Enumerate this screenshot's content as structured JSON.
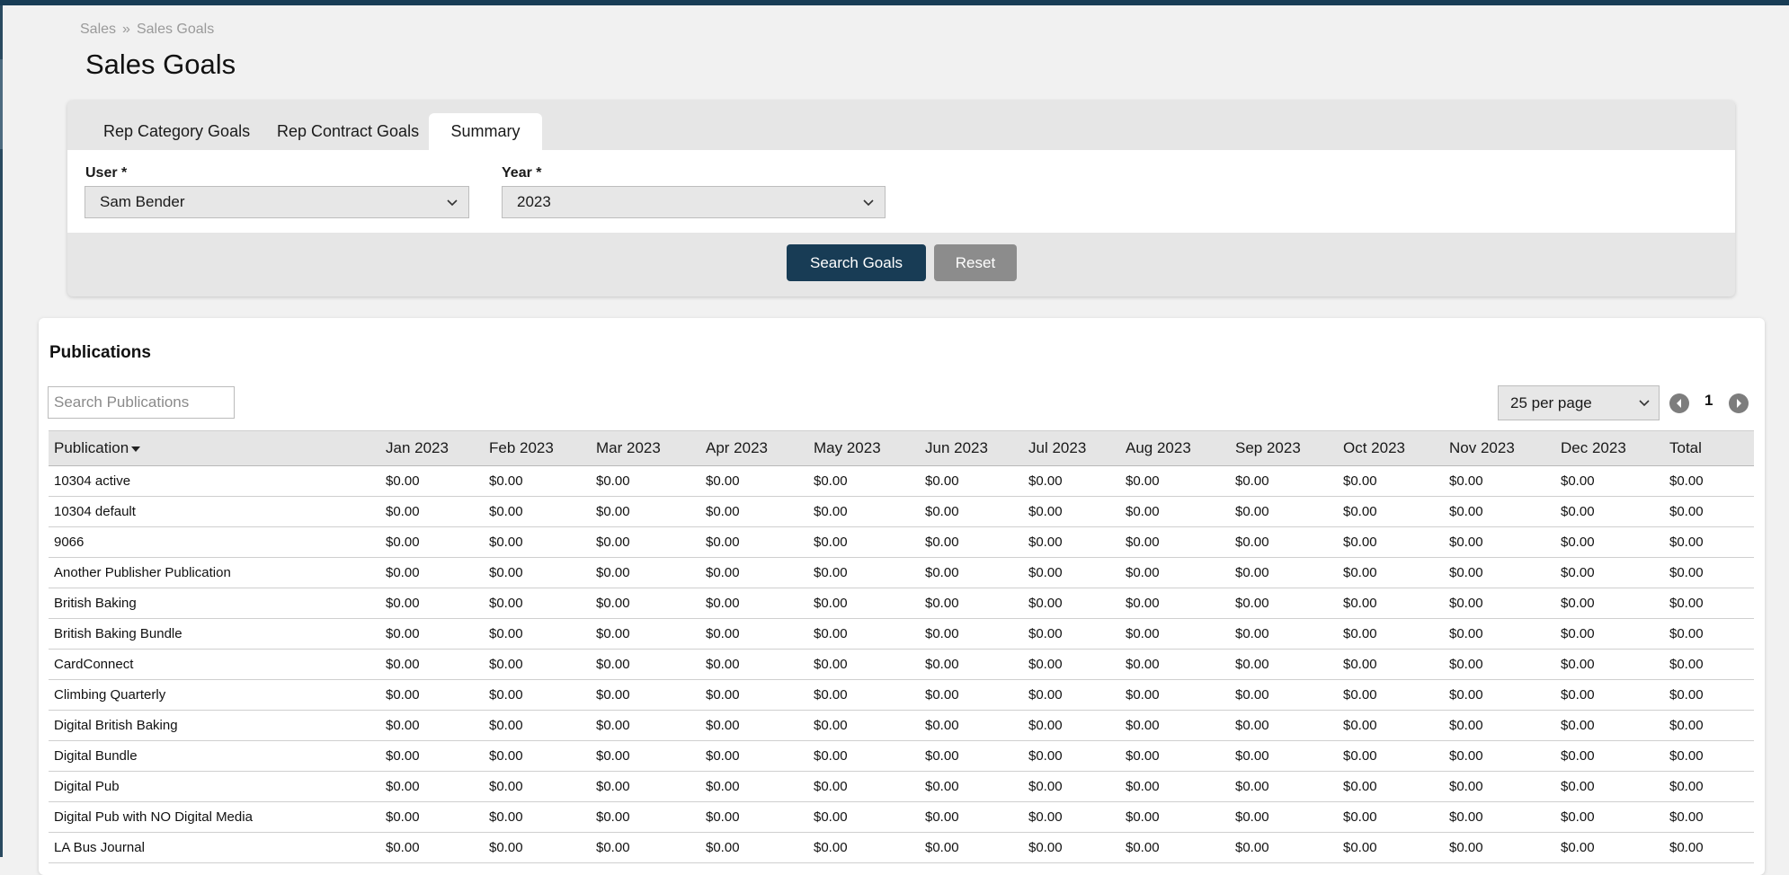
{
  "breadcrumb": {
    "parent": "Sales",
    "separator": "»",
    "current": "Sales Goals"
  },
  "page_title": "Sales Goals",
  "tabs": [
    {
      "label": "Rep Category Goals",
      "active": false
    },
    {
      "label": "Rep Contract Goals",
      "active": false
    },
    {
      "label": "Summary",
      "active": true
    }
  ],
  "filters": {
    "user_label": "User *",
    "user_value": "Sam Bender",
    "year_label": "Year *",
    "year_value": "2023"
  },
  "buttons": {
    "search": "Search Goals",
    "reset": "Reset"
  },
  "publications": {
    "title": "Publications",
    "search_placeholder": "Search Publications",
    "per_page": "25 per page",
    "page": "1",
    "columns": [
      "Publication",
      "Jan 2023",
      "Feb 2023",
      "Mar 2023",
      "Apr 2023",
      "May 2023",
      "Jun 2023",
      "Jul 2023",
      "Aug 2023",
      "Sep 2023",
      "Oct 2023",
      "Nov 2023",
      "Dec 2023",
      "Total"
    ],
    "rows": [
      {
        "name": "10304 active",
        "values": [
          "$0.00",
          "$0.00",
          "$0.00",
          "$0.00",
          "$0.00",
          "$0.00",
          "$0.00",
          "$0.00",
          "$0.00",
          "$0.00",
          "$0.00",
          "$0.00",
          "$0.00"
        ]
      },
      {
        "name": "10304 default",
        "values": [
          "$0.00",
          "$0.00",
          "$0.00",
          "$0.00",
          "$0.00",
          "$0.00",
          "$0.00",
          "$0.00",
          "$0.00",
          "$0.00",
          "$0.00",
          "$0.00",
          "$0.00"
        ]
      },
      {
        "name": "9066",
        "values": [
          "$0.00",
          "$0.00",
          "$0.00",
          "$0.00",
          "$0.00",
          "$0.00",
          "$0.00",
          "$0.00",
          "$0.00",
          "$0.00",
          "$0.00",
          "$0.00",
          "$0.00"
        ]
      },
      {
        "name": "Another Publisher Publication",
        "values": [
          "$0.00",
          "$0.00",
          "$0.00",
          "$0.00",
          "$0.00",
          "$0.00",
          "$0.00",
          "$0.00",
          "$0.00",
          "$0.00",
          "$0.00",
          "$0.00",
          "$0.00"
        ]
      },
      {
        "name": "British Baking",
        "values": [
          "$0.00",
          "$0.00",
          "$0.00",
          "$0.00",
          "$0.00",
          "$0.00",
          "$0.00",
          "$0.00",
          "$0.00",
          "$0.00",
          "$0.00",
          "$0.00",
          "$0.00"
        ]
      },
      {
        "name": "British Baking Bundle",
        "values": [
          "$0.00",
          "$0.00",
          "$0.00",
          "$0.00",
          "$0.00",
          "$0.00",
          "$0.00",
          "$0.00",
          "$0.00",
          "$0.00",
          "$0.00",
          "$0.00",
          "$0.00"
        ]
      },
      {
        "name": "CardConnect",
        "values": [
          "$0.00",
          "$0.00",
          "$0.00",
          "$0.00",
          "$0.00",
          "$0.00",
          "$0.00",
          "$0.00",
          "$0.00",
          "$0.00",
          "$0.00",
          "$0.00",
          "$0.00"
        ]
      },
      {
        "name": "Climbing Quarterly",
        "values": [
          "$0.00",
          "$0.00",
          "$0.00",
          "$0.00",
          "$0.00",
          "$0.00",
          "$0.00",
          "$0.00",
          "$0.00",
          "$0.00",
          "$0.00",
          "$0.00",
          "$0.00"
        ]
      },
      {
        "name": "Digital British Baking",
        "values": [
          "$0.00",
          "$0.00",
          "$0.00",
          "$0.00",
          "$0.00",
          "$0.00",
          "$0.00",
          "$0.00",
          "$0.00",
          "$0.00",
          "$0.00",
          "$0.00",
          "$0.00"
        ]
      },
      {
        "name": "Digital Bundle",
        "values": [
          "$0.00",
          "$0.00",
          "$0.00",
          "$0.00",
          "$0.00",
          "$0.00",
          "$0.00",
          "$0.00",
          "$0.00",
          "$0.00",
          "$0.00",
          "$0.00",
          "$0.00"
        ]
      },
      {
        "name": "Digital Pub",
        "values": [
          "$0.00",
          "$0.00",
          "$0.00",
          "$0.00",
          "$0.00",
          "$0.00",
          "$0.00",
          "$0.00",
          "$0.00",
          "$0.00",
          "$0.00",
          "$0.00",
          "$0.00"
        ]
      },
      {
        "name": "Digital Pub with NO Digital Media",
        "values": [
          "$0.00",
          "$0.00",
          "$0.00",
          "$0.00",
          "$0.00",
          "$0.00",
          "$0.00",
          "$0.00",
          "$0.00",
          "$0.00",
          "$0.00",
          "$0.00",
          "$0.00"
        ]
      },
      {
        "name": "LA Bus Journal",
        "values": [
          "$0.00",
          "$0.00",
          "$0.00",
          "$0.00",
          "$0.00",
          "$0.00",
          "$0.00",
          "$0.00",
          "$0.00",
          "$0.00",
          "$0.00",
          "$0.00",
          "$0.00"
        ]
      }
    ]
  },
  "colors": {
    "primary": "#183c55",
    "secondary_button": "#8c8c8c",
    "header_bg": "#e5e5e5",
    "page_bg": "#f1f1f1"
  },
  "icons": {
    "select_chevron": "chevron-down-icon",
    "prev_page": "chevron-left-icon",
    "next_page": "chevron-right-icon"
  }
}
